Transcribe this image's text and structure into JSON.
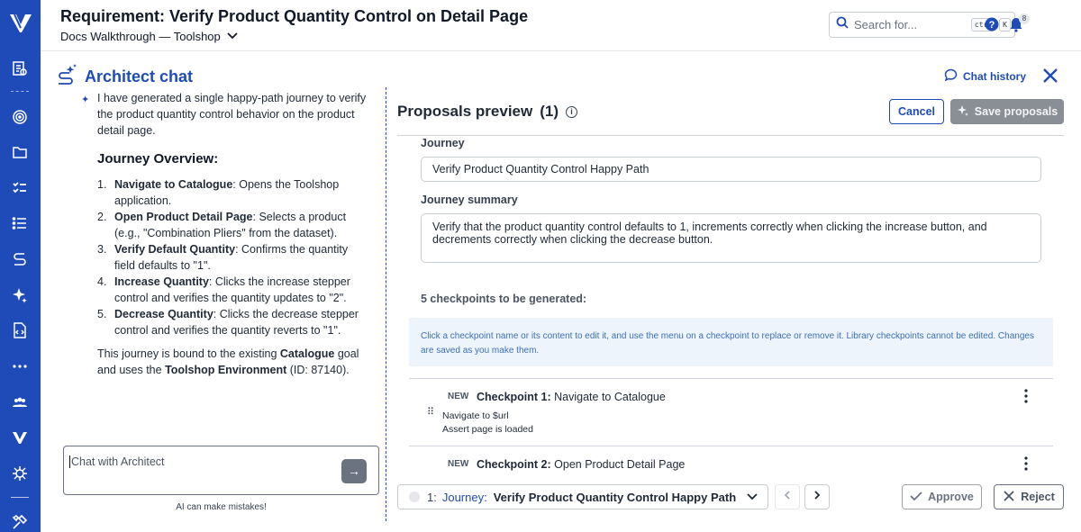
{
  "header": {
    "title": "Requirement: Verify Product Quantity Control on Detail Page",
    "project": "Docs Walkthrough — Toolshop",
    "search_placeholder": "Search for...",
    "shortcut_ctrl": "ctrl",
    "shortcut_key": "K",
    "notification_count": "8"
  },
  "sidebar": {
    "icons": [
      "logo-icon",
      "requirements-icon",
      "target-icon",
      "folder-icon",
      "checklist-icon",
      "list-icon",
      "journey-icon",
      "sparkle-icon",
      "file-code-icon",
      "more-icon",
      "team-icon",
      "integrations-icon",
      "bug-icon",
      "tools-icon"
    ]
  },
  "chat": {
    "title": "Architect chat",
    "history_label": "Chat history",
    "intro": "I have generated a single happy-path journey to verify the product quantity control behavior on the product detail page.",
    "overview_heading": "Journey Overview:",
    "steps": [
      {
        "num": "1.",
        "name": "Navigate to Catalogue",
        "desc": ": Opens the Toolshop application."
      },
      {
        "num": "2.",
        "name": "Open Product Detail Page",
        "desc": ": Selects a product (e.g., \"Combination Pliers\" from the dataset)."
      },
      {
        "num": "3.",
        "name": "Verify Default Quantity",
        "desc": ": Confirms the quantity field defaults to \"1\"."
      },
      {
        "num": "4.",
        "name": "Increase Quantity",
        "desc": ": Clicks the increase stepper control and verifies the quantity updates to \"2\"."
      },
      {
        "num": "5.",
        "name": "Decrease Quantity",
        "desc": ": Clicks the decrease stepper control and verifies the quantity reverts to \"1\"."
      }
    ],
    "outro_a": "This journey is bound to the existing ",
    "outro_b": "Catalogue",
    "outro_c": " goal and uses the ",
    "outro_d": "Toolshop Environment",
    "outro_e": " (ID: 87140).",
    "input_placeholder": "Chat with Architect",
    "send_label": "→",
    "disclaimer": "AI can make mistakes!"
  },
  "proposals": {
    "title": "Proposals preview",
    "count": "(1)",
    "cancel_label": "Cancel",
    "save_label": "Save proposals",
    "journey_label": "Journey",
    "journey_value": "Verify Product Quantity Control Happy Path",
    "summary_label": "Journey summary",
    "summary_value": "Verify that the product quantity control defaults to 1, increments correctly when clicking the increase button, and decrements correctly when clicking the decrease button.",
    "checkpoint_count": "5 checkpoints to be generated:",
    "notice": "Click a checkpoint name or its content to edit it, and use the menu on a checkpoint to replace or remove it. Library checkpoints cannot be edited. Changes are saved as you make them.",
    "checkpoints": [
      {
        "badge": "NEW",
        "label": "Checkpoint 1:",
        "name": "Navigate to Catalogue",
        "steps": [
          "Navigate to $url",
          "Assert page is loaded"
        ]
      },
      {
        "badge": "NEW",
        "label": "Checkpoint 2:",
        "name": "Open Product Detail Page",
        "steps": []
      }
    ]
  },
  "footer": {
    "index": "1:",
    "journey_label": "Journey:",
    "journey_name": "Verify Product Quantity Control Happy Path",
    "approve_label": "Approve",
    "reject_label": "Reject"
  },
  "colors": {
    "brand": "#1f4bb8",
    "notice_bg": "#eef4fb",
    "disabled_button": "#8a8f96"
  }
}
